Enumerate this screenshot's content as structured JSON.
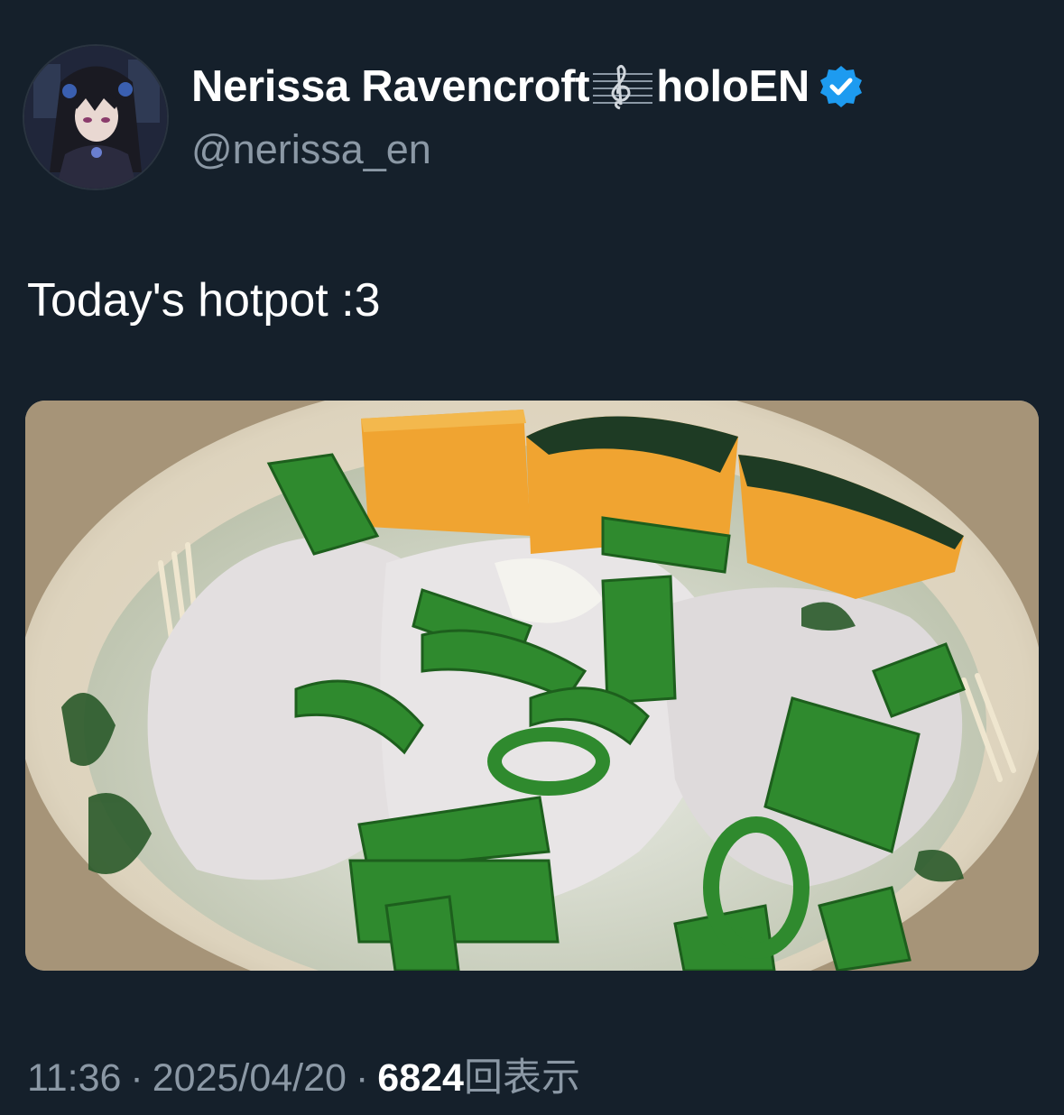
{
  "author": {
    "display_name_part1": "Nerissa Ravencroft",
    "display_name_part2": "holoEN",
    "handle": "@nerissa_en",
    "verified": true,
    "avatar_icon": "avatar-image",
    "emoji_icon": "musical-score-icon"
  },
  "tweet": {
    "text": "Today's hotpot :3",
    "media_icon": "hotpot-photo"
  },
  "meta": {
    "time": "11:36",
    "separator": "·",
    "date": "2025/04/20",
    "views_count": "6824",
    "views_label": "回表示"
  },
  "colors": {
    "background": "#15202b",
    "secondary_text": "#8b98a5",
    "verified_blue": "#1d9bf0"
  }
}
